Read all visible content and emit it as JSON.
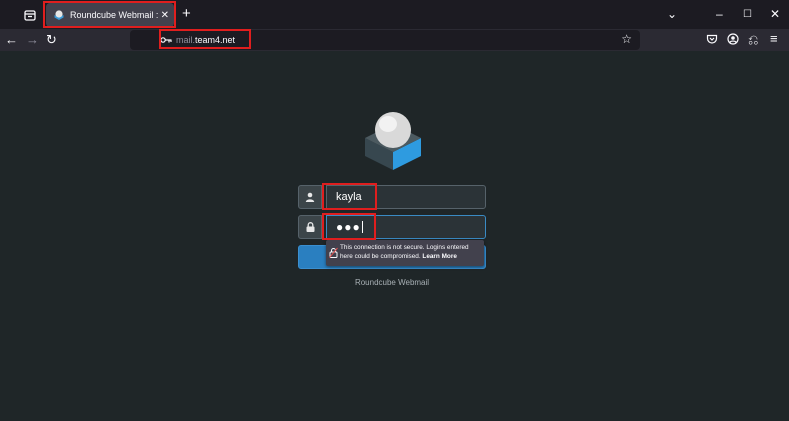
{
  "browser": {
    "tab": {
      "title": "Roundcube Webmail :: Welcome to Roundcube Webmail"
    },
    "url": {
      "prefix": "mail.",
      "domain": "team4.net"
    }
  },
  "login": {
    "username_value": "kayla",
    "password_value": "●●●"
  },
  "security_warning": {
    "message": "This connection is not secure. Logins entered here could be compromised.",
    "link": "Learn More"
  },
  "footer": {
    "text": "Roundcube Webmail"
  },
  "colors": {
    "accent": "#2a7fc0",
    "background": "#1f2628",
    "annotation": "#e01e1e"
  },
  "icons": [
    "tab-list-icon",
    "favicon-icon",
    "close-tab-icon",
    "new-tab-icon",
    "chevron-down-icon",
    "minimize-icon",
    "maximize-icon",
    "close-window-icon",
    "back-icon",
    "forward-icon",
    "reload-icon",
    "shield-icon",
    "lock-slash-icon",
    "key-icon",
    "star-icon",
    "pocket-icon",
    "account-icon",
    "extensions-icon",
    "menu-icon",
    "user-icon",
    "lock-icon"
  ]
}
